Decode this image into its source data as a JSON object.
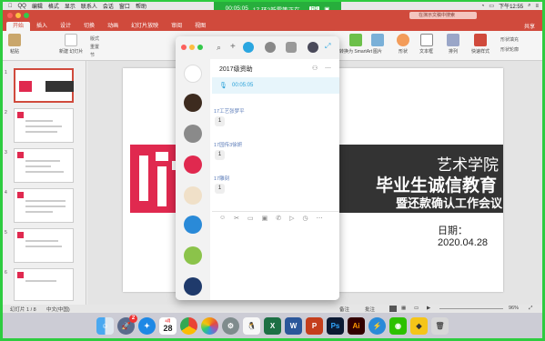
{
  "menubar": {
    "items": [
      "QQ",
      "编辑",
      "格式",
      "显示",
      "联系人",
      "会话",
      "窗口",
      "帮助"
    ],
    "time": "下午12:55"
  },
  "recording": {
    "elapsed": "00:05:05",
    "label": "17 环2新雪等正在...",
    "badge": "HD"
  },
  "ppt": {
    "search_placeholder": "在演示文稿中搜索",
    "tabs": [
      "开始",
      "插入",
      "设计",
      "切换",
      "动画",
      "幻灯片放映",
      "审阅",
      "视图"
    ],
    "share_label": "共享",
    "ribbon": {
      "paste": "粘贴",
      "new_slide": "新建\n幻灯片",
      "layout": "版式",
      "reset": "重置",
      "section": "节",
      "convert_smartart": "转换为\nSmartArt",
      "picture": "图片",
      "shape": "形状",
      "textbox": "文本框",
      "arrange": "排列",
      "quick_styles": "快速样式",
      "shape_fill": "形状填充",
      "shape_outline": "形状轮廓"
    },
    "slide": {
      "college": "艺术学院",
      "title": "毕业生诚信教育",
      "subtitle": "暨还款确认工作会议",
      "date": "日期：2020.04.28"
    },
    "thumb_numbers": [
      "1",
      "2",
      "3",
      "4",
      "5",
      "6"
    ],
    "status": {
      "slide_count": "幻灯片 1 / 8",
      "language": "中文(中国)",
      "notes": "备注",
      "comments": "批注",
      "zoom": "96%"
    }
  },
  "chat": {
    "title": "2017级资助",
    "voice_time": "00:05:05",
    "messages": [
      {
        "sender": "17工艺张梦平",
        "text": "1"
      },
      {
        "sender": "17园传3徐妍",
        "text": "1"
      },
      {
        "sender": "17雕刻",
        "text": "1"
      }
    ]
  },
  "dock": {
    "badge_count": "2",
    "calendar_day": "28",
    "calendar_month": "4月",
    "apps": [
      "Finder",
      "Launchpad",
      "Safari",
      "Calendar",
      "Chrome",
      "Photos",
      "System Preferences",
      "QQ",
      "Excel",
      "Word",
      "PowerPoint",
      "Photoshop",
      "Illustrator",
      "Xunlei",
      "WeChat",
      "Maps",
      "Trash"
    ]
  }
}
